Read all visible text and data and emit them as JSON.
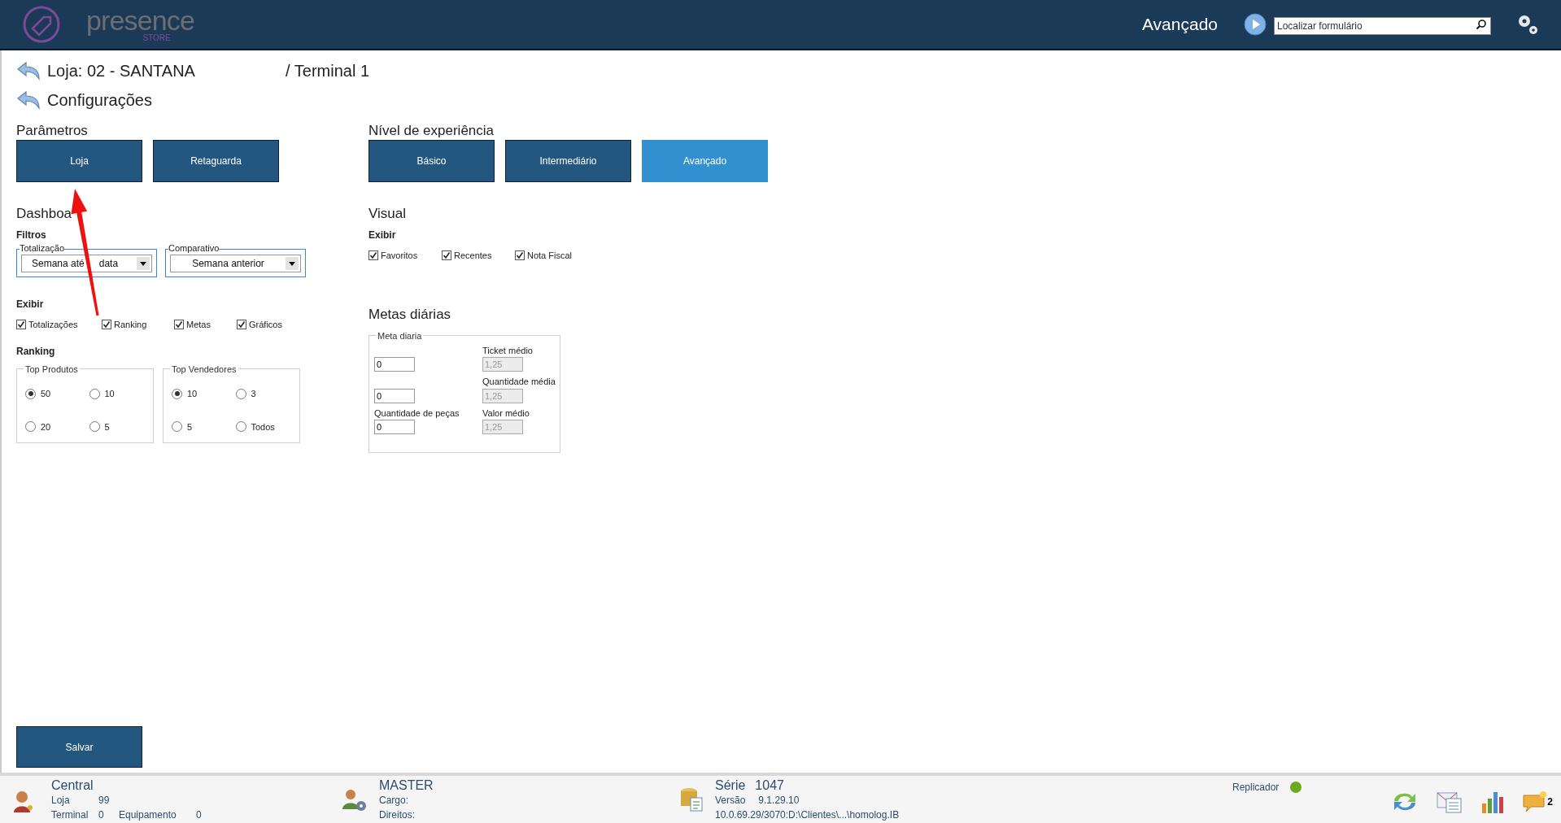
{
  "header": {
    "logo_text": "presence",
    "logo_sub": "STORE",
    "level_label": "Avançado",
    "search": {
      "placeholder": "Localizar formulário"
    }
  },
  "breadcrumb": {
    "store": "Loja: 02 - SANTANA",
    "terminal": "/ Terminal 1",
    "section": "Configurações"
  },
  "parametros": {
    "title": "Parâmetros",
    "buttons": [
      {
        "label": "Loja",
        "selected": false
      },
      {
        "label": "Retaguarda",
        "selected": false
      }
    ]
  },
  "nivel": {
    "title": "Nível de experiência",
    "buttons": [
      {
        "label": "Básico",
        "selected": false
      },
      {
        "label": "Intermediário",
        "selected": false
      },
      {
        "label": "Avançado",
        "selected": true
      }
    ]
  },
  "dashboard": {
    "title": "Dashboa",
    "filtros_title": "Filtros",
    "filters": [
      {
        "legend": "Totalização",
        "value_parts": [
          "Semana até",
          "data"
        ]
      },
      {
        "legend": "Comparativo",
        "value_parts": [
          "Semana anterior"
        ]
      }
    ],
    "exibir_title": "Exibir",
    "exibir": [
      {
        "label": "Totalizações",
        "checked": true
      },
      {
        "label": "Ranking",
        "checked": true
      },
      {
        "label": "Metas",
        "checked": true
      },
      {
        "label": "Gráficos",
        "checked": true
      }
    ],
    "ranking_title": "Ranking",
    "ranking_groups": [
      {
        "legend": "Top Produtos",
        "options": [
          {
            "label": "50",
            "selected": true
          },
          {
            "label": "10",
            "selected": false
          },
          {
            "label": "20",
            "selected": false
          },
          {
            "label": "5",
            "selected": false
          }
        ]
      },
      {
        "legend": "Top Vendedores",
        "options": [
          {
            "label": "10",
            "selected": true
          },
          {
            "label": "3",
            "selected": false
          },
          {
            "label": "5",
            "selected": false
          },
          {
            "label": "Todos",
            "selected": false
          }
        ]
      }
    ]
  },
  "visual": {
    "title": "Visual",
    "exibir_title": "Exibir",
    "exibir": [
      {
        "label": "Favoritos",
        "checked": true
      },
      {
        "label": "Recentes",
        "checked": true
      },
      {
        "label": "Nota Fiscal",
        "checked": true
      }
    ]
  },
  "metas": {
    "title": "Metas diárias",
    "legend": "Meta diaria",
    "rows": [
      {
        "left_value": "0",
        "right_label": "Ticket médio",
        "right_value": "1,25"
      },
      {
        "left_value": "0",
        "right_label": "Quantidade média",
        "right_value": "1,25"
      },
      {
        "left_label": "Quantidade de peças",
        "left_value": "0",
        "right_label": "Valor médio",
        "right_value": "1,25"
      }
    ]
  },
  "save_button": "Salvar",
  "status_bar": {
    "user": {
      "name": "Central",
      "lines": [
        [
          "Loja",
          "99"
        ],
        [
          "Terminal",
          "0",
          "Equipamento",
          "0"
        ]
      ]
    },
    "role": {
      "name": "MASTER",
      "lines": [
        "Cargo:",
        "Direitos:"
      ]
    },
    "serie": {
      "title": "Série",
      "number": "1047",
      "version_label": "Versão",
      "version": "9.1.29.10",
      "path": "10.0.69.29/3070:D:\\Clientes\\...\\homolog.IB"
    },
    "replicador": {
      "label": "Replicador",
      "color": "#6aaa1e"
    },
    "messages_count": "2"
  }
}
